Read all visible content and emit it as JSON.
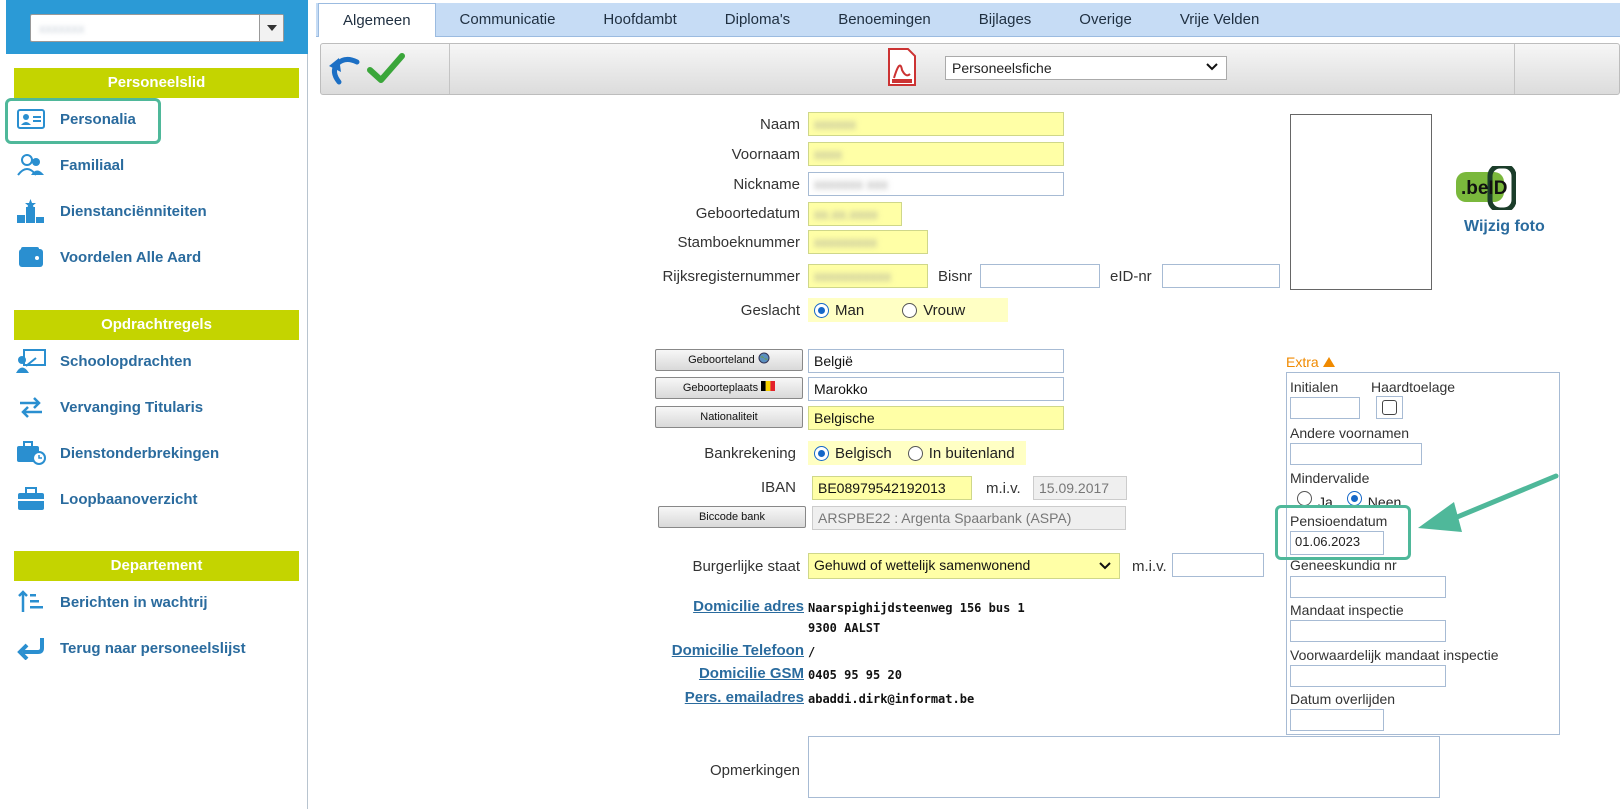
{
  "sidebar": {
    "sections": {
      "personeelslid": "Personeelslid",
      "opdrachtregels": "Opdrachtregels",
      "departement": "Departement"
    },
    "items": {
      "personalia": "Personalia",
      "familiaal": "Familiaal",
      "dienstancienniteiten": "Dienstanciënniteiten",
      "voordelen": "Voordelen Alle Aard",
      "schoolopdrachten": "Schoolopdrachten",
      "vervanging": "Vervanging Titularis",
      "dienstonderbrekingen": "Dienstonderbrekingen",
      "loopbaan": "Loopbaanoverzicht",
      "berichten": "Berichten in wachtrij",
      "terug": "Terug naar personeelslijst"
    }
  },
  "tabs": [
    "Algemeen",
    "Communicatie",
    "Hoofdambt",
    "Diploma's",
    "Benoemingen",
    "Bijlages",
    "Overige",
    "Vrije Velden"
  ],
  "toolbar": {
    "doc_select": "Personeelsfiche"
  },
  "form": {
    "naam": "Naam",
    "voornaam": "Voornaam",
    "nickname": "Nickname",
    "geboortedatum": "Geboortedatum",
    "stamboeknummer": "Stamboeknummer",
    "rijksregister": "Rijksregisternummer",
    "bisnr": "Bisnr",
    "eidnr": "eID-nr",
    "geslacht": "Geslacht",
    "man": "Man",
    "vrouw": "Vrouw",
    "geboorteland_btn": "Geboorteland",
    "geboorteland": "België",
    "geboorteplaats_btn": "Geboorteplaats",
    "geboorteplaats": "Marokko",
    "nationaliteit_btn": "Nationaliteit",
    "nationaliteit": "Belgische",
    "bankrekening": "Bankrekening",
    "belgisch": "Belgisch",
    "buitenland": "In buitenland",
    "iban": "IBAN",
    "iban_value": "BE08979542192013",
    "miv": "m.i.v.",
    "iban_miv": "15.09.2017",
    "biccode_btn": "Biccode bank",
    "biccode": "ARSPBE22 : Argenta Spaarbank (ASPA)",
    "burgerlijke_staat": "Burgerlijke staat",
    "burgerlijke_value": "Gehuwd of wettelijk samenwonend",
    "domicilie_adres": "Domicilie adres",
    "adres_line1": "Naarspighijdsteenweg 156 bus 1",
    "adres_line2": "9300 AALST",
    "domicilie_telefoon": "Domicilie Telefoon",
    "telefoon": "/",
    "domicilie_gsm": "Domicilie GSM",
    "gsm": "0405 95 95 20",
    "pers_email": "Pers. emailadres",
    "email": "abaddi.dirk@informat.be",
    "opmerkingen": "Opmerkingen"
  },
  "photo": {
    "wijzig": "Wijzig foto",
    "logo_text": ".beID"
  },
  "extra": {
    "title": "Extra",
    "initialen": "Initialen",
    "haardtoelage": "Haardtoelage",
    "andere_voornamen": "Andere voornamen",
    "mindervalide": "Mindervalide",
    "ja": "Ja",
    "neen": "Neen",
    "pensioendatum": "Pensioendatum",
    "pensioendatum_value": "01.06.2023",
    "geneeskundig": "Geneeskundig nr",
    "mandaat": "Mandaat inspectie",
    "voorwaardelijk": "Voorwaardelijk mandaat inspectie",
    "overlijden": "Datum overlijden"
  },
  "colors": {
    "accent_blue": "#2b9ad6",
    "section_green": "#c4d400",
    "highlight": "#4fb89a",
    "required": "#ffffa6"
  }
}
